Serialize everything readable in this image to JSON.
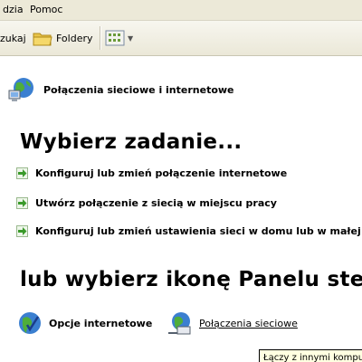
{
  "menubar": {
    "items": [
      {
        "label": "dzia"
      },
      {
        "label": "Pomoc"
      }
    ]
  },
  "toolbar": {
    "search_label": "zukaj",
    "folders_label": "Foldery"
  },
  "header": {
    "title": "Połączenia sieciowe i internetowe"
  },
  "tasks": {
    "heading": "Wybierz zadanie...",
    "items": [
      {
        "label": "Konfiguruj lub zmień połączenie internetowe"
      },
      {
        "label": "Utwórz połączenie z siecią w miejscu pracy"
      },
      {
        "label": "Konfiguruj lub zmień ustawienia sieci w domu lub w małej firmie"
      }
    ]
  },
  "control_panel": {
    "heading": "lub wybierz ikonę Panelu sterowania",
    "items": [
      {
        "label": "Opcje internetowe"
      },
      {
        "label": "Połączenia sieciowe"
      }
    ]
  },
  "tooltip": {
    "text": "Łączy z innymi komputerami"
  },
  "colors": {
    "menubar_bg": "#ece9d8",
    "arrow_green": "#3a9a2a",
    "tooltip_bg": "#ffffe1"
  }
}
